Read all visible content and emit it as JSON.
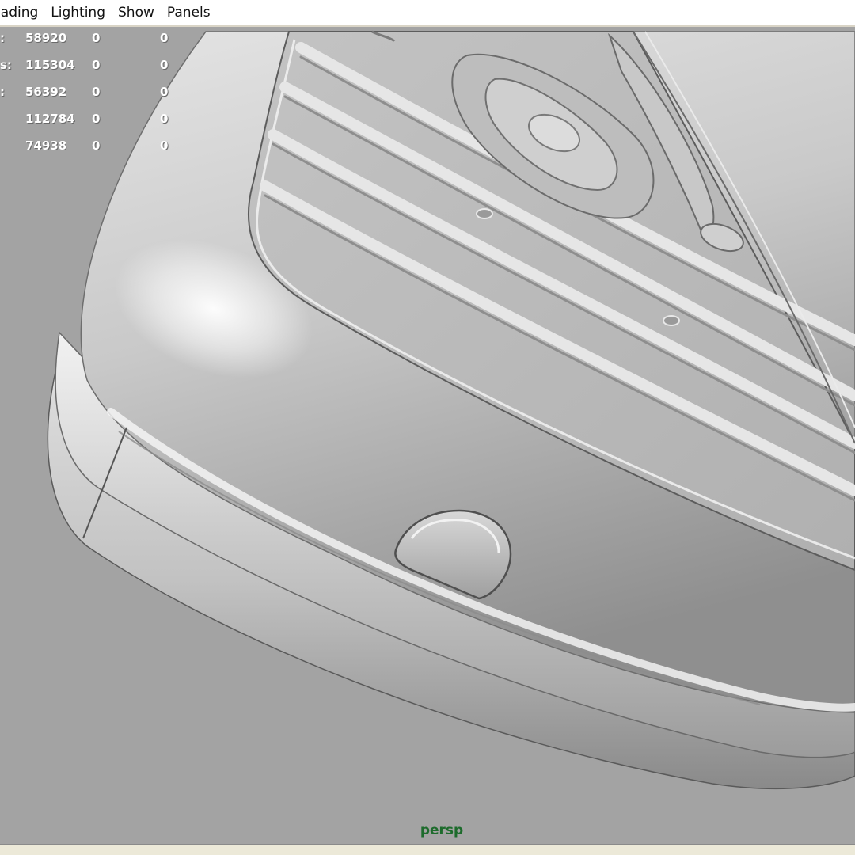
{
  "menu": {
    "items": [
      "nading",
      "Lighting",
      "Show",
      "Panels"
    ]
  },
  "hud": {
    "rows": [
      {
        "label": ":",
        "total": "58920",
        "selected": "0",
        "selected2": "0"
      },
      {
        "label": "s:",
        "total": "115304",
        "selected": "0",
        "selected2": "0"
      },
      {
        "label": ":",
        "total": "56392",
        "selected": "0",
        "selected2": "0"
      },
      {
        "label": "",
        "total": "112784",
        "selected": "0",
        "selected2": "0"
      },
      {
        "label": "",
        "total": "74938",
        "selected": "0",
        "selected2": "0"
      }
    ]
  },
  "viewport": {
    "camera": "persp",
    "background_color": "#a3a3a3",
    "model": "phone-body-3d-model"
  },
  "colors": {
    "camera_label": "#1d6b2c",
    "hud_text": "#ffffff",
    "menubar_bg": "#ffffff"
  }
}
